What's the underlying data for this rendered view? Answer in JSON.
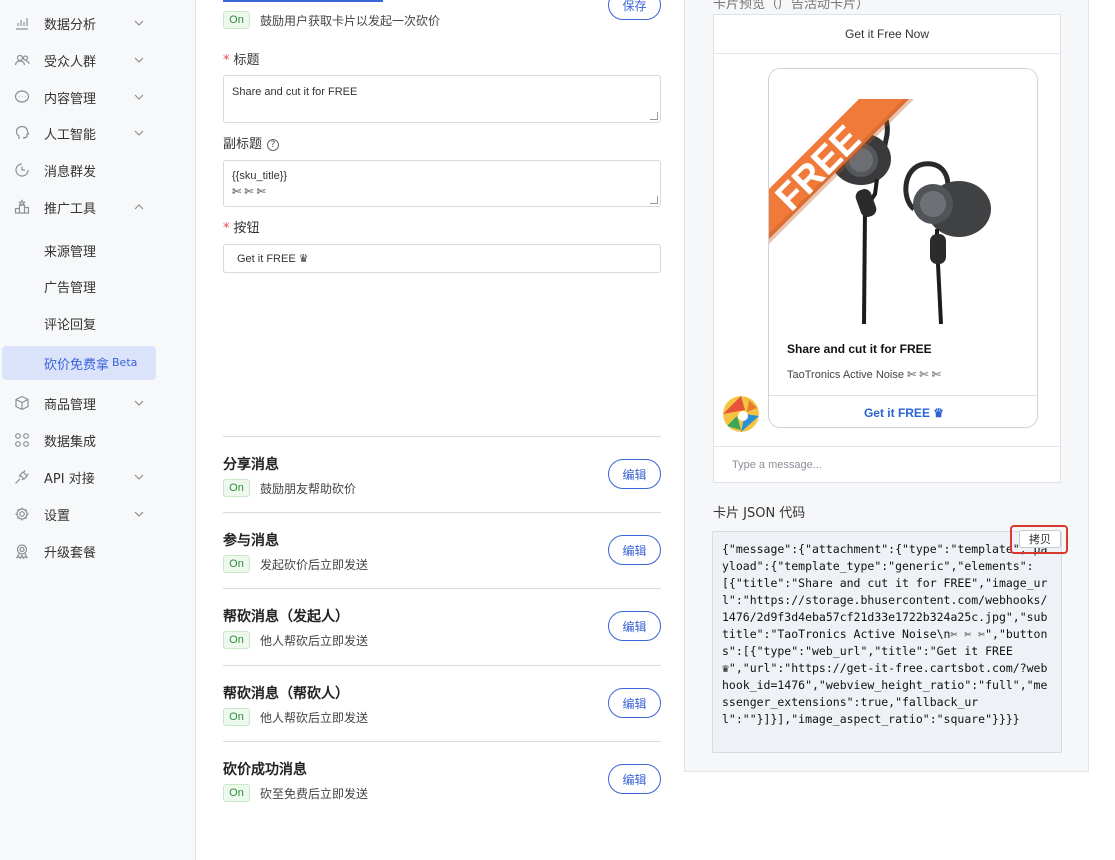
{
  "sidebar": {
    "items": [
      {
        "label": "数据分析",
        "icon": "chart-icon"
      },
      {
        "label": "受众人群",
        "icon": "users-icon"
      },
      {
        "label": "内容管理",
        "icon": "chat-icon"
      },
      {
        "label": "人工智能",
        "icon": "brain-icon"
      },
      {
        "label": "消息群发",
        "icon": "clock-icon"
      },
      {
        "label": "推广工具",
        "icon": "podium-icon"
      }
    ],
    "sub_items": [
      {
        "label": "来源管理"
      },
      {
        "label": "广告管理"
      },
      {
        "label": "评论回复"
      },
      {
        "label": "砍价免费拿",
        "badge": "Beta"
      }
    ],
    "items_bottom": [
      {
        "label": "商品管理",
        "icon": "box-icon"
      },
      {
        "label": "数据集成",
        "icon": "grid-icon"
      },
      {
        "label": "API 对接",
        "icon": "plug-icon"
      },
      {
        "label": "设置",
        "icon": "gear-icon"
      },
      {
        "label": "升级套餐",
        "icon": "upgrade-icon"
      }
    ]
  },
  "main": {
    "card_section": {
      "on_label": "On",
      "description": "鼓励用户获取卡片以发起一次砍价",
      "save_label": "保存",
      "title_label": "标题",
      "title_value": "Share and cut it for FREE",
      "subtitle_label": "副标题",
      "subtitle_value": "{{sku_title}}\n✄ ✄ ✄",
      "button_label": "按钮",
      "button_value": "Get it FREE ♛"
    },
    "messages": [
      {
        "title": "分享消息",
        "on": "On",
        "desc": "鼓励朋友帮助砍价",
        "edit": "编辑"
      },
      {
        "title": "参与消息",
        "on": "On",
        "desc": "发起砍价后立即发送",
        "edit": "编辑"
      },
      {
        "title": "帮砍消息（发起人）",
        "on": "On",
        "desc": "他人帮砍后立即发送",
        "edit": "编辑"
      },
      {
        "title": "帮砍消息（帮砍人）",
        "on": "On",
        "desc": "他人帮砍后立即发送",
        "edit": "编辑"
      },
      {
        "title": "砍价成功消息",
        "on": "On",
        "desc": "砍至免费后立即发送",
        "edit": "编辑"
      }
    ]
  },
  "preview": {
    "header_faded": "卡片预览（广告活动卡片）",
    "top_label": "Get it Free Now",
    "card_banner": "FREE",
    "card_title": "Share and cut it for FREE",
    "card_subtitle": "TaoTronics Active Noise ✄ ✄ ✄",
    "card_button": "Get it FREE ♛",
    "input_placeholder": "Type a message..."
  },
  "json_section": {
    "label": "卡片 JSON 代码",
    "copy_label": "拷贝",
    "code": "{\"message\":{\"attachment\":{\"type\":\"template\",\"payload\":{\"template_type\":\"generic\",\"elements\":[{\"title\":\"Share and cut it for FREE\",\"image_url\":\"https://storage.bhusercontent.com/webhooks/1476/2d9f3d4eba57cf21d33e1722b324a25c.jpg\",\"subtitle\":\"TaoTronics Active Noise\\n✄ ✄ ✄\",\"buttons\":[{\"type\":\"web_url\",\"title\":\"Get it FREE ♛\",\"url\":\"https://get-it-free.cartsbot.com/?webhook_id=1476\",\"webview_height_ratio\":\"full\",\"messenger_extensions\":true,\"fallback_url\":\"\"}]}],\"image_aspect_ratio\":\"square\"}}}}"
  }
}
